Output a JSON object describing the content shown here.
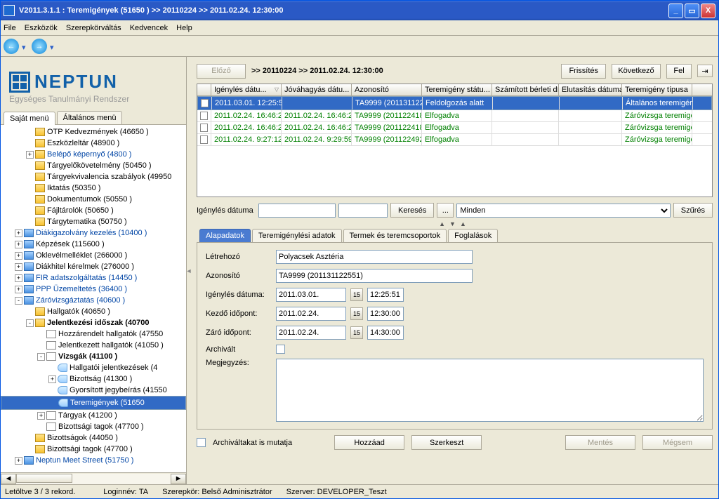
{
  "title": "V2011.3.1.1 : Teremigények (51650  )  >> 20110224 >> 2011.02.24. 12:30:00",
  "menu": [
    "File",
    "Eszközök",
    "Szerepkörváltás",
    "Kedvencek",
    "Help"
  ],
  "logo": {
    "text": "NEPTUN",
    "sub": "Egységes Tanulmányi Rendszer"
  },
  "left_tabs": {
    "own": "Saját menü",
    "gen": "Általános menü"
  },
  "tree": [
    {
      "d": 2,
      "ic": "y",
      "t": "OTP Kedvezmények (46650  )"
    },
    {
      "d": 2,
      "ic": "y",
      "t": "Eszközleltár (48900  )"
    },
    {
      "d": 2,
      "tw": "+",
      "ic": "y",
      "t": "Belépő képernyő (4800  )",
      "cls": "link"
    },
    {
      "d": 2,
      "ic": "y",
      "t": "Tárgyelőkövetelmény (50450  )"
    },
    {
      "d": 2,
      "ic": "y",
      "t": "Tárgyekvivalencia szabályok (49950"
    },
    {
      "d": 2,
      "ic": "y",
      "t": "Iktatás (50350  )"
    },
    {
      "d": 2,
      "ic": "y",
      "t": "Dokumentumok (50550  )"
    },
    {
      "d": 2,
      "ic": "y",
      "t": "Fájltárolók (50650  )"
    },
    {
      "d": 2,
      "ic": "y",
      "t": "Tárgytematika (50750  )"
    },
    {
      "d": 1,
      "tw": "+",
      "ic": "b",
      "t": "Diákigazolvány kezelés (10400  )",
      "cls": "link"
    },
    {
      "d": 1,
      "tw": "+",
      "ic": "b",
      "t": "Képzések (115600  )"
    },
    {
      "d": 1,
      "tw": "+",
      "ic": "b",
      "t": "Oklevélmelléklet (266000  )"
    },
    {
      "d": 1,
      "tw": "+",
      "ic": "b",
      "t": "Diákhitel kérelmek (276000  )"
    },
    {
      "d": 1,
      "tw": "+",
      "ic": "b",
      "t": "FIR adatszolgáltatás (14450  )",
      "cls": "link"
    },
    {
      "d": 1,
      "tw": "+",
      "ic": "b",
      "t": "PPP Üzemeltetés (36400  )",
      "cls": "link"
    },
    {
      "d": 1,
      "tw": "-",
      "ic": "b",
      "t": "Záróvizsgáztatás (40600  )",
      "cls": "link"
    },
    {
      "d": 2,
      "ic": "y",
      "t": "Hallgatók (40650  )"
    },
    {
      "d": 2,
      "tw": "-",
      "ic": "y",
      "t": "Jelentkezési időszak (40700",
      "cls": "bold"
    },
    {
      "d": 3,
      "ic": "d",
      "t": "Hozzárendelt hallgatók (47550"
    },
    {
      "d": 3,
      "ic": "d",
      "t": "Jelentkezett hallgatók (41050  )"
    },
    {
      "d": 3,
      "tw": "-",
      "ic": "d",
      "t": "Vizsgák  (41100  )",
      "cls": "bold"
    },
    {
      "d": 4,
      "ic": "c",
      "t": "Hallgatói jelentkezések (4"
    },
    {
      "d": 4,
      "tw": "+",
      "ic": "c",
      "t": "Bizottság (41300  )"
    },
    {
      "d": 4,
      "ic": "c",
      "t": "Gyorsított jegybeírás (41550"
    },
    {
      "d": 4,
      "ic": "c",
      "t": "Teremigények (51650",
      "sel": true
    },
    {
      "d": 3,
      "tw": "+",
      "ic": "d",
      "t": "Tárgyak (41200  )"
    },
    {
      "d": 3,
      "ic": "d",
      "t": "Bizottsági tagok (47700  )"
    },
    {
      "d": 2,
      "ic": "y",
      "t": "Bizottságok (44050  )"
    },
    {
      "d": 2,
      "ic": "y",
      "t": "Bizottsági tagok (47700  )"
    },
    {
      "d": 1,
      "tw": "+",
      "ic": "b",
      "t": "Neptun Meet Street (51750  )",
      "cls": "link"
    }
  ],
  "top": {
    "prev": "Előző",
    "crumb": ">>  20110224 >> 2011.02.24. 12:30:00",
    "refresh": "Frissítés",
    "next": "Következő",
    "up": "Fel"
  },
  "grid": {
    "cols": [
      "",
      "Igénylés dátu...",
      "Jóváhagyás dátu...",
      "Azonosító",
      "Teremigény státu...",
      "Számított bérleti díj",
      "Elutasítás dátuma",
      "Teremigény típusa"
    ],
    "rows": [
      {
        "sel": true,
        "cells": [
          "2011.03.01. 12:25:5",
          "",
          "TA9999 (201131122",
          "Feldolgozás alatt",
          "",
          "",
          "Általános teremigény"
        ]
      },
      {
        "green": true,
        "cells": [
          "2011.02.24. 16:46:2",
          "2011.02.24. 16:46:2",
          "TA9999 (201122418",
          "Elfogadva",
          "",
          "",
          "Záróvizsga teremigé"
        ]
      },
      {
        "green": true,
        "cells": [
          "2011.02.24. 16:46:2",
          "2011.02.24. 16:46:2",
          "TA9999 (201122418",
          "Elfogadva",
          "",
          "",
          "Záróvizsga teremigé"
        ]
      },
      {
        "green": true,
        "cells": [
          "2011.02.24. 9:27:12",
          "2011.02.24. 9:29:59",
          "TA9999 (201122492",
          "Elfogadva",
          "",
          "",
          "Záróvizsga teremigé"
        ]
      }
    ]
  },
  "filter": {
    "label": "Igénylés dátuma",
    "search": "Keresés",
    "dots": "...",
    "all": "Minden",
    "fil": "Szűrés"
  },
  "dtabs": [
    "Alapadatok",
    "Teremigénylési adatok",
    "Termek és teremcsoportok",
    "Foglalások"
  ],
  "form": {
    "creator_l": "Létrehozó",
    "creator": "Polyacsek Asztéria",
    "id_l": "Azonosító",
    "id": "TA9999 (201131122551)",
    "req_l": "Igénylés dátuma:",
    "req_d": "2011.03.01.",
    "req_t": "12:25:51",
    "start_l": "Kezdő időpont:",
    "start_d": "2011.02.24.",
    "start_t": "12:30:00",
    "end_l": "Záró időpont:",
    "end_d": "2011.02.24.",
    "end_t": "14:30:00",
    "arch_l": "Archivált",
    "note_l": "Megjegyzés:"
  },
  "bottom": {
    "show_arch": "Archiváltakat is mutatja",
    "add": "Hozzáad",
    "edit": "Szerkeszt",
    "save": "Mentés",
    "cancel": "Mégsem"
  },
  "status": {
    "rec": "Letöltve 3 / 3 rekord.",
    "login": "Loginnév: TA",
    "role": "Szerepkör: Belső Adminisztrátor",
    "srv": "Szerver: DEVELOPER_Teszt"
  }
}
